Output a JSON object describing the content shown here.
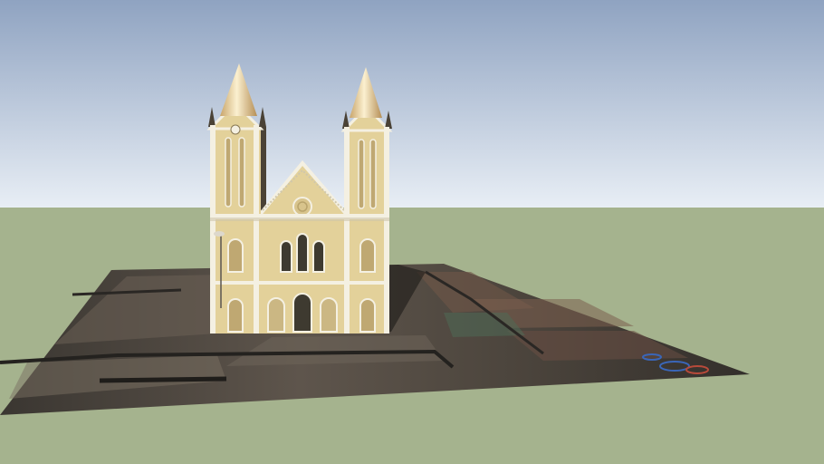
{
  "scene": {
    "subject": "church-3d-model",
    "colors": {
      "sky_top": "#8fa3c1",
      "sky_bottom": "#e6edf4",
      "ground": "#a5b38e",
      "facade": "#e3d19a",
      "facade_shadow": "#c9b57d",
      "trim": "#f4f0e2",
      "spire": "#e9d39f",
      "window": "#3e3a30",
      "terrain_dark": "#2e2c28",
      "terrain_mid": "#5a5148"
    }
  }
}
